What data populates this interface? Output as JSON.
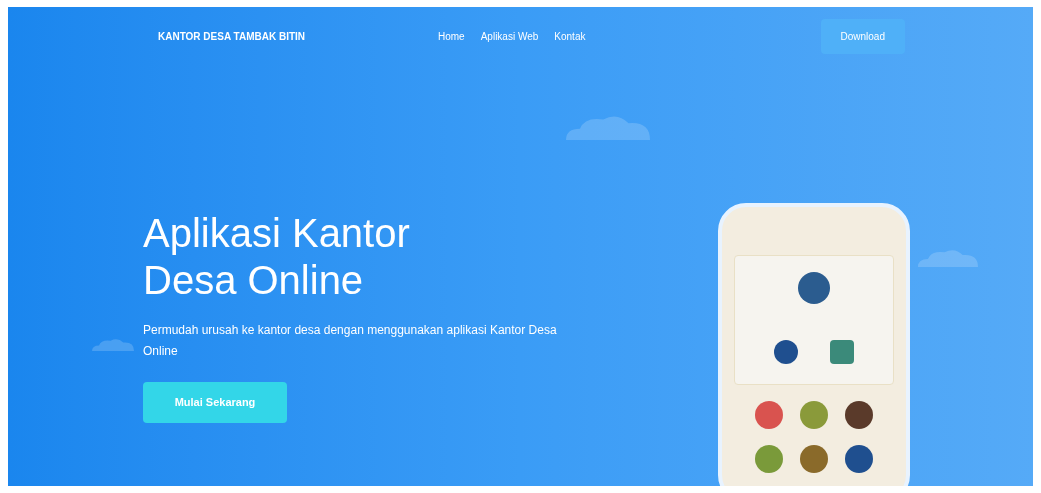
{
  "navbar": {
    "brand": "KANTOR DESA TAMBAK BITIN",
    "links": [
      "Home",
      "Aplikasi Web",
      "Kontak"
    ],
    "cta": "Download"
  },
  "hero": {
    "title_lines": [
      "Aplikasi Kantor",
      "Desa Online"
    ],
    "subtitle": "Permudah urusah ke kantor desa dengan menggunakan aplikasi Kantor Desa Online",
    "button": "Mulai Sekarang"
  },
  "phone": {
    "menu_icons": [
      {
        "color": "#d9534f"
      },
      {
        "color": "#8a9a3a"
      },
      {
        "color": "#5a3a2a"
      },
      {
        "color": "#7a9a3a"
      },
      {
        "color": "#8a6a2a"
      },
      {
        "color": "#1f4f8f"
      }
    ]
  }
}
